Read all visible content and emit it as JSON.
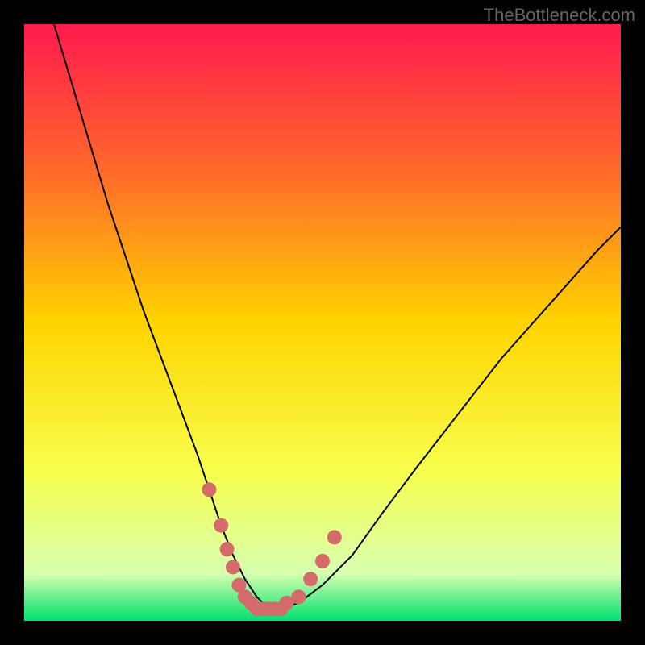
{
  "watermark": "TheBottleneck.com",
  "chart_data": {
    "type": "line",
    "title": "",
    "xlabel": "",
    "ylabel": "",
    "xlim": [
      0,
      100
    ],
    "ylim": [
      0,
      100
    ],
    "background_gradient": {
      "stops": [
        {
          "offset": 0,
          "color": "#ff1a4d"
        },
        {
          "offset": 25,
          "color": "#ff6a2a"
        },
        {
          "offset": 50,
          "color": "#ffd400"
        },
        {
          "offset": 75,
          "color": "#f7ff4d"
        },
        {
          "offset": 92,
          "color": "#d8ffb0"
        },
        {
          "offset": 100,
          "color": "#00e070"
        }
      ]
    },
    "series": [
      {
        "name": "curve",
        "color": "#000000",
        "x": [
          5,
          8,
          11,
          14,
          17,
          20,
          23,
          26,
          29,
          31,
          33,
          35,
          37,
          39,
          41,
          43,
          46,
          50,
          55,
          60,
          66,
          73,
          80,
          88,
          96,
          100
        ],
        "y": [
          100,
          90,
          80,
          70,
          61,
          52,
          44,
          36,
          28,
          22,
          16,
          11,
          7,
          4,
          2,
          2,
          3,
          6,
          11,
          18,
          26,
          35,
          44,
          53,
          62,
          66
        ]
      }
    ],
    "marker_region": {
      "color": "#d46a6a",
      "points": [
        {
          "x": 31,
          "y": 22
        },
        {
          "x": 33,
          "y": 16
        },
        {
          "x": 34,
          "y": 12
        },
        {
          "x": 35,
          "y": 9
        },
        {
          "x": 36,
          "y": 6
        },
        {
          "x": 37,
          "y": 4
        },
        {
          "x": 38,
          "y": 3
        },
        {
          "x": 39,
          "y": 2
        },
        {
          "x": 40,
          "y": 2
        },
        {
          "x": 41,
          "y": 2
        },
        {
          "x": 42,
          "y": 2
        },
        {
          "x": 43,
          "y": 2
        },
        {
          "x": 44,
          "y": 3
        },
        {
          "x": 46,
          "y": 4
        },
        {
          "x": 48,
          "y": 7
        },
        {
          "x": 50,
          "y": 10
        },
        {
          "x": 52,
          "y": 14
        }
      ]
    }
  }
}
